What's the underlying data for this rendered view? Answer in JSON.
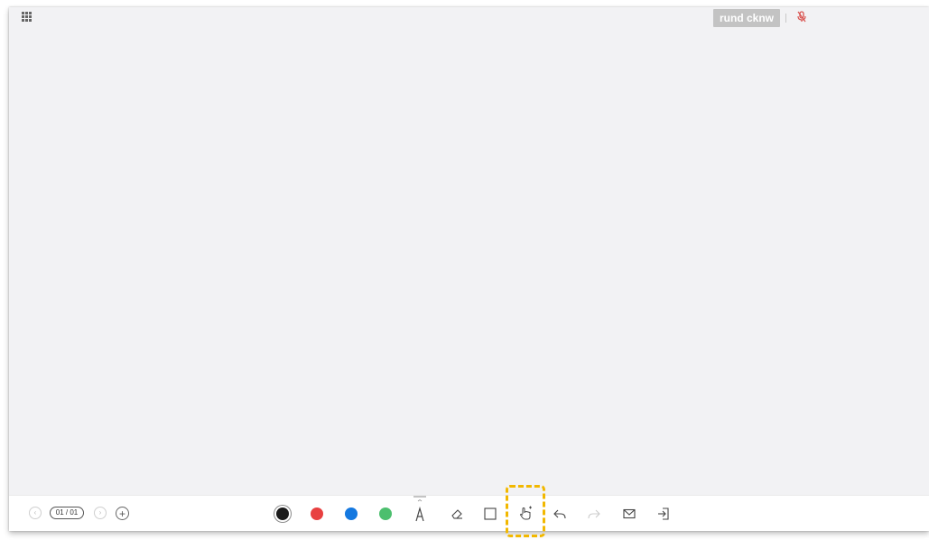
{
  "header": {
    "user_name": "rund cknw"
  },
  "toolbar": {
    "page_counter": "01 / 01",
    "colors": [
      "#1a1a1a",
      "#e84040",
      "#1478e0",
      "#4cbf6e"
    ],
    "selected_color": "#1a1a1a",
    "highlight_color": "#f2b800",
    "icons": [
      "prev-page-icon",
      "next-page-icon",
      "add-page-icon",
      "text-tool-icon",
      "eraser-icon",
      "rectangle-icon",
      "hand-pointer-icon",
      "undo-icon",
      "redo-icon",
      "mail-icon",
      "exit-icon"
    ]
  }
}
